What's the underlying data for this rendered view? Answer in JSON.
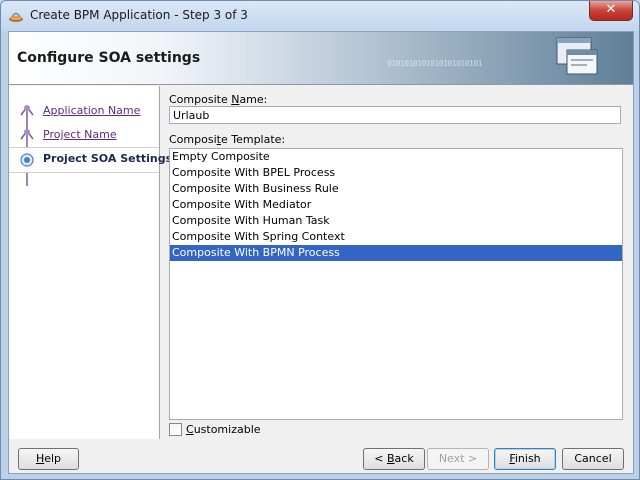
{
  "window": {
    "title": "Create BPM Application - Step 3 of 3",
    "close_symbol": "✕"
  },
  "header": {
    "title": "Configure SOA settings",
    "binary_text": "0101010101010101010101"
  },
  "nav": {
    "items": [
      {
        "label": "Application Name",
        "state": "completed"
      },
      {
        "label": "Project Name",
        "state": "completed"
      },
      {
        "label": "Project SOA Settings",
        "state": "current"
      }
    ],
    "scroll_left": "<",
    "scroll_right": ">"
  },
  "form": {
    "composite_name_label_pre": "Composite ",
    "composite_name_label_mn": "N",
    "composite_name_label_post": "ame:",
    "composite_name_value": "Urlaub",
    "composite_template_label_pre": "Composi",
    "composite_template_label_mn": "t",
    "composite_template_label_post": "e Template:",
    "templates": [
      "Empty Composite",
      "Composite With BPEL Process",
      "Composite With Business Rule",
      "Composite With Mediator",
      "Composite With Human Task",
      "Composite With Spring Context",
      "Composite With BPMN Process"
    ],
    "selected_template": "Composite With BPMN Process",
    "customizable_label_mn": "C",
    "customizable_label_post": "ustomizable",
    "customizable_checked": false
  },
  "buttons": {
    "help": {
      "mn": "H",
      "rest": "elp"
    },
    "back": {
      "pre": "< ",
      "mn": "B",
      "rest": "ack"
    },
    "next": {
      "label": "Next >"
    },
    "finish": {
      "mn": "F",
      "rest": "inish"
    },
    "cancel": {
      "label": "Cancel"
    }
  },
  "colors": {
    "selection": "#3265c4",
    "link": "#5b2d7c",
    "close_button": "#c7433a"
  }
}
